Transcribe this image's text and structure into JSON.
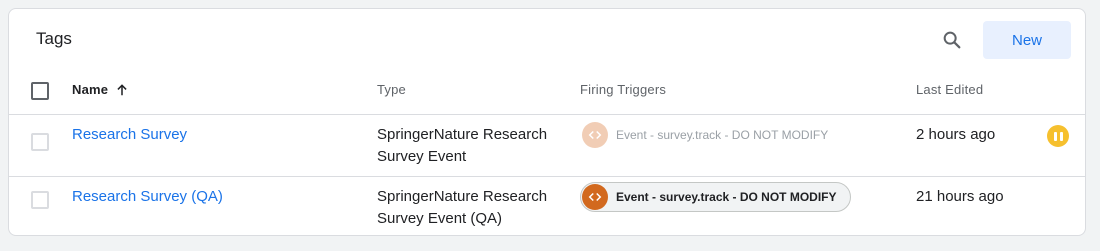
{
  "card": {
    "title": "Tags",
    "new_label": "New"
  },
  "icons": {
    "search": "search-icon",
    "sort": "arrow-upward-icon",
    "trigger": "code-brackets-icon",
    "paused": "pause-icon"
  },
  "colors": {
    "link": "#1a73e8",
    "trigger_icon": "#d2691e",
    "paused_badge": "#f6c02e"
  },
  "table": {
    "columns": {
      "name": "Name",
      "type": "Type",
      "firing_triggers": "Firing Triggers",
      "last_edited": "Last Edited"
    },
    "rows": [
      {
        "name": "Research Survey",
        "type_line1": "SpringerNature Research",
        "type_line2": "Survey Event",
        "trigger": "Event - survey.track - DO NOT MODIFY",
        "last_edited": "2 hours ago",
        "status": "paused"
      },
      {
        "name": "Research Survey (QA)",
        "type_line1": "SpringerNature Research",
        "type_line2": "Survey Event (QA)",
        "trigger": "Event - survey.track - DO NOT MODIFY",
        "last_edited": "21 hours ago",
        "status": "active"
      }
    ]
  }
}
